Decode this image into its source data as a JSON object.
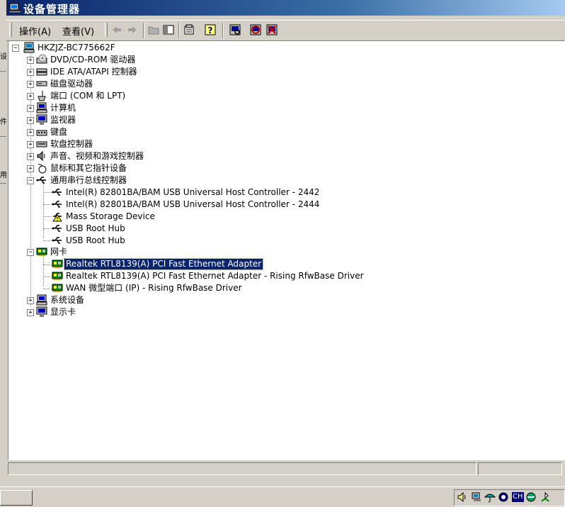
{
  "window": {
    "title": "设备管理器"
  },
  "menu": {
    "action": "操作(A)",
    "view": "查看(V)"
  },
  "toolbar_icons": [
    "back-arrow-icon",
    "forward-arrow-icon",
    "folder-up-icon",
    "console-tree-icon",
    "properties-icon",
    "help-icon",
    "scan-hardware-icon",
    "disable-device-icon",
    "uninstall-device-icon"
  ],
  "tree": {
    "root": "HKZJZ-BC775662F",
    "categories": [
      {
        "label": "DVD/CD-ROM 驱动器",
        "icon": "cdrom-icon",
        "expanded": false
      },
      {
        "label": "IDE ATA/ATAPI 控制器",
        "icon": "ide-controller-icon",
        "expanded": false
      },
      {
        "label": "磁盘驱动器",
        "icon": "disk-drive-icon",
        "expanded": false
      },
      {
        "label": "端口 (COM 和 LPT)",
        "icon": "port-icon",
        "expanded": false
      },
      {
        "label": "计算机",
        "icon": "computer-icon",
        "expanded": false
      },
      {
        "label": "监视器",
        "icon": "monitor-icon",
        "expanded": false
      },
      {
        "label": "键盘",
        "icon": "keyboard-icon",
        "expanded": false
      },
      {
        "label": "软盘控制器",
        "icon": "floppy-controller-icon",
        "expanded": false
      },
      {
        "label": "声音、视频和游戏控制器",
        "icon": "sound-icon",
        "expanded": false
      },
      {
        "label": "鼠标和其它指针设备",
        "icon": "mouse-icon",
        "expanded": false
      },
      {
        "label": "通用串行总线控制器",
        "icon": "usb-icon",
        "expanded": true,
        "children": [
          {
            "label": "Intel(R) 82801BA/BAM USB Universal Host Controller - 2442",
            "icon": "usb-icon"
          },
          {
            "label": "Intel(R) 82801BA/BAM USB Universal Host Controller - 2444",
            "icon": "usb-icon"
          },
          {
            "label": "Mass Storage Device",
            "icon": "warning-icon"
          },
          {
            "label": "USB Root Hub",
            "icon": "usb-icon"
          },
          {
            "label": "USB Root Hub",
            "icon": "usb-icon"
          }
        ]
      },
      {
        "label": "网卡",
        "icon": "network-card-icon",
        "expanded": true,
        "children": [
          {
            "label": "Realtek RTL8139(A) PCI Fast Ethernet Adapter",
            "icon": "network-card-icon",
            "selected": true
          },
          {
            "label": "Realtek RTL8139(A) PCI Fast Ethernet Adapter - Rising RfwBase Driver",
            "icon": "network-card-icon"
          },
          {
            "label": "WAN 微型端口 (IP) - Rising RfwBase Driver",
            "icon": "network-card-icon"
          }
        ]
      },
      {
        "label": "系统设备",
        "icon": "system-device-icon",
        "expanded": false
      },
      {
        "label": "显示卡",
        "icon": "display-adapter-icon",
        "expanded": false
      }
    ]
  },
  "background_window": {
    "fragments": [
      "设",
      "件",
      "用"
    ]
  },
  "tray": {
    "input_method": "CH",
    "icons": [
      "volume-icon",
      "network-tray-icon",
      "umbrella-icon",
      "antivirus-icon",
      "input-method-icon",
      "ie-icon",
      "clock-icon"
    ]
  },
  "colors": {
    "title_start": "#0a246a",
    "title_end": "#a6caf0",
    "selection": "#0a246a"
  }
}
